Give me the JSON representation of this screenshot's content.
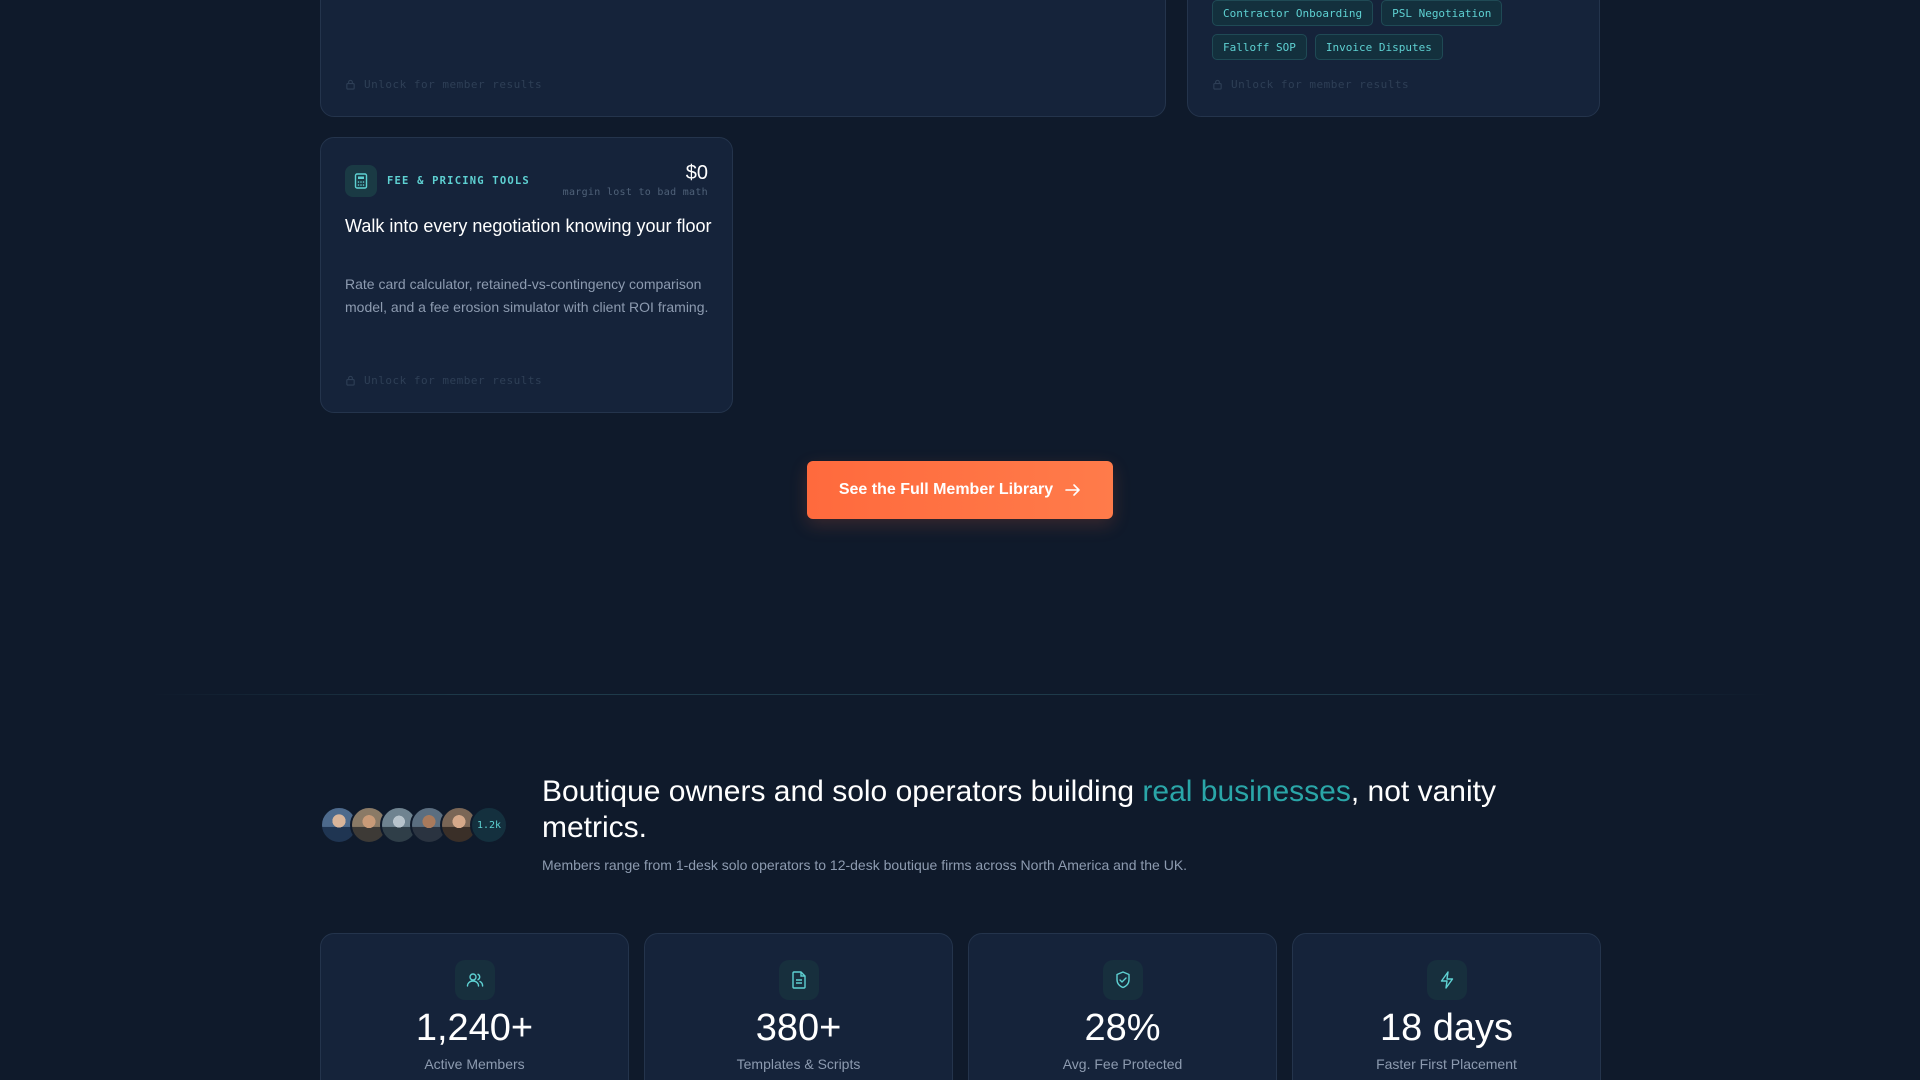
{
  "locked_text": "Unlock for member results",
  "top_right_card": {
    "chips": [
      "Contractor Onboarding",
      "PSL Negotiation",
      "Falloff SOP",
      "Invoice Disputes"
    ]
  },
  "fee_card": {
    "category": "FEE & PRICING TOOLS",
    "icon": "calculator-icon",
    "stat_value": "$0",
    "stat_caption": "margin lost to bad math",
    "title": "Walk into every negotiation knowing your floor",
    "description": "Rate card calculator, retained-vs-contingency comparison model, and a fee erosion simulator with client ROI framing."
  },
  "cta": {
    "label": "See the Full Member Library",
    "icon": "arrow-right-icon"
  },
  "community": {
    "headline_before": "Boutique owners and solo operators building ",
    "headline_accent": "real businesses",
    "headline_after": ", not vanity metrics.",
    "subline": "Members range from 1-desk solo operators to 12-desk boutique firms across North America and the UK.",
    "avatar_count_label": "1.2k"
  },
  "stats": [
    {
      "icon": "users-icon",
      "value": "1,240+",
      "label": "Active Members"
    },
    {
      "icon": "document-icon",
      "value": "380+",
      "label": "Templates & Scripts"
    },
    {
      "icon": "shield-check-icon",
      "value": "28%",
      "label": "Avg. Fee Protected"
    },
    {
      "icon": "lightning-icon",
      "value": "18 days",
      "label": "Faster First Placement"
    }
  ],
  "colors": {
    "background": "#0f1a2b",
    "card": "#15233a",
    "accent_teal": "#5ed1d2",
    "cta_orange": "#ff6a3d"
  }
}
